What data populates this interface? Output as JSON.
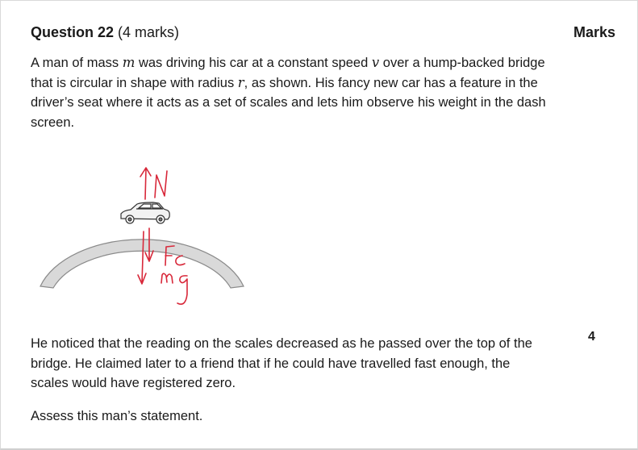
{
  "question": {
    "title": "Question 22",
    "marks_text": "(4 marks)"
  },
  "marks_column": {
    "heading": "Marks",
    "value": "4"
  },
  "paragraph1": {
    "a": "A man of mass ",
    "m": "m",
    "b": " was driving his car at a constant speed ",
    "v": "v",
    "c": " over a hump-backed bridge that is circular in shape with radius ",
    "r": "r",
    "d": ", as shown. His fancy new car has a feature in the driver’s seat where it acts as a set of scales and lets him observe his weight in the dash screen."
  },
  "paragraph2": "He noticed that the reading on the scales decreased as he passed over the top of the bridge. He claimed later to a friend that if he could have travelled fast enough, the scales would have registered zero.",
  "paragraph3": "Assess this man’s statement.",
  "diagram": {
    "annotations": [
      "N",
      "Fc",
      "mg"
    ],
    "ink_color": "#d8283a",
    "bridge_color": "#d9d9d9"
  }
}
